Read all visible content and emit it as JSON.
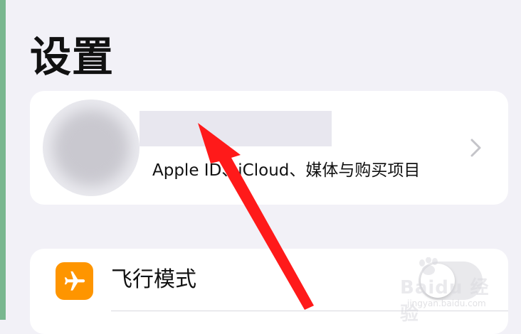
{
  "header": {
    "title": "设置"
  },
  "profile": {
    "subtitle": "Apple ID、iCloud、媒体与购买项目"
  },
  "settings": {
    "items": [
      {
        "label": "飞行模式",
        "icon": "airplane-icon",
        "toggle_on": false
      }
    ]
  },
  "watermark": {
    "brand": "Baidu 经验",
    "url": "jingyan.baidu.com"
  },
  "colors": {
    "background": "#f2f1f7",
    "card": "#ffffff",
    "airplane_icon": "#fe9500",
    "annotation_arrow": "#ff1a1a"
  }
}
